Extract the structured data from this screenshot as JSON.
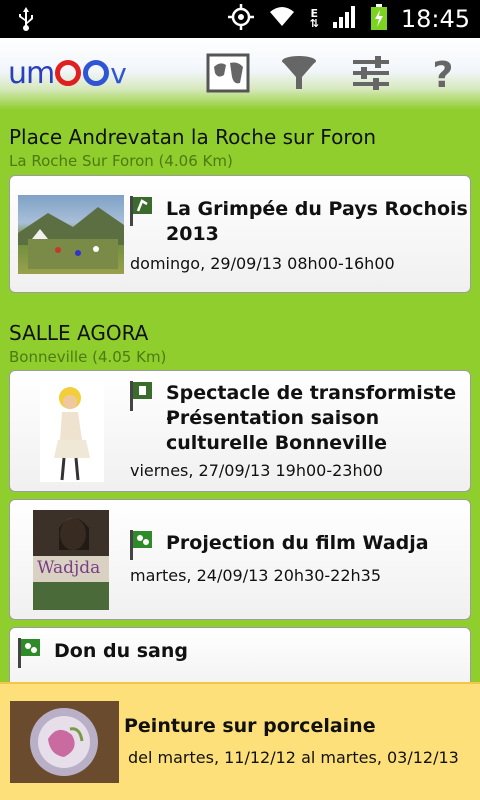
{
  "status_bar": {
    "time": "18:45",
    "usb_icon": "usb-icon",
    "icons": [
      "gps-icon",
      "wifi-icon",
      "data-e-icon",
      "signal-icon",
      "battery-charging-icon"
    ]
  },
  "header": {
    "logo_text": "umOOv",
    "logo_prefix": "um",
    "buttons": [
      {
        "name": "map-button",
        "icon": "map-icon"
      },
      {
        "name": "filter-button",
        "icon": "funnel-icon"
      },
      {
        "name": "settings-button",
        "icon": "sliders-icon"
      },
      {
        "name": "help-button",
        "icon": "question-icon",
        "label": "?"
      }
    ]
  },
  "places": [
    {
      "name": "Place Andrevatan la Roche sur Foron",
      "location": "La Roche Sur Foron (4.06 Km)",
      "events": [
        {
          "title_line1": "La Grimpée du Pays Rochois",
          "title_line2": "2013",
          "date": "domingo, 29/09/13 08h00-16h00"
        }
      ]
    },
    {
      "name": "SALLE AGORA",
      "location": "Bonneville (4.05 Km)",
      "events": [
        {
          "title_line1": "Spectacle de transformiste -",
          "title_line2": "Présentation saison",
          "title_line3": "culturelle Bonneville",
          "date": "viernes, 27/09/13 19h00-23h00"
        },
        {
          "title_line1": "Projection du film  Wadja",
          "date": "martes, 24/09/13 20h30-22h35",
          "poster_text": "Wadjda"
        },
        {
          "title_line1": "Don du sang"
        }
      ]
    }
  ],
  "banner": {
    "title": "Peinture sur porcelaine",
    "date": "del martes, 11/12/12 al martes, 03/12/13"
  },
  "colors": {
    "background": "#8fce2c",
    "location_text": "#4d7a12",
    "banner": "#fde07a",
    "flag_green": "#2f8a2a"
  }
}
